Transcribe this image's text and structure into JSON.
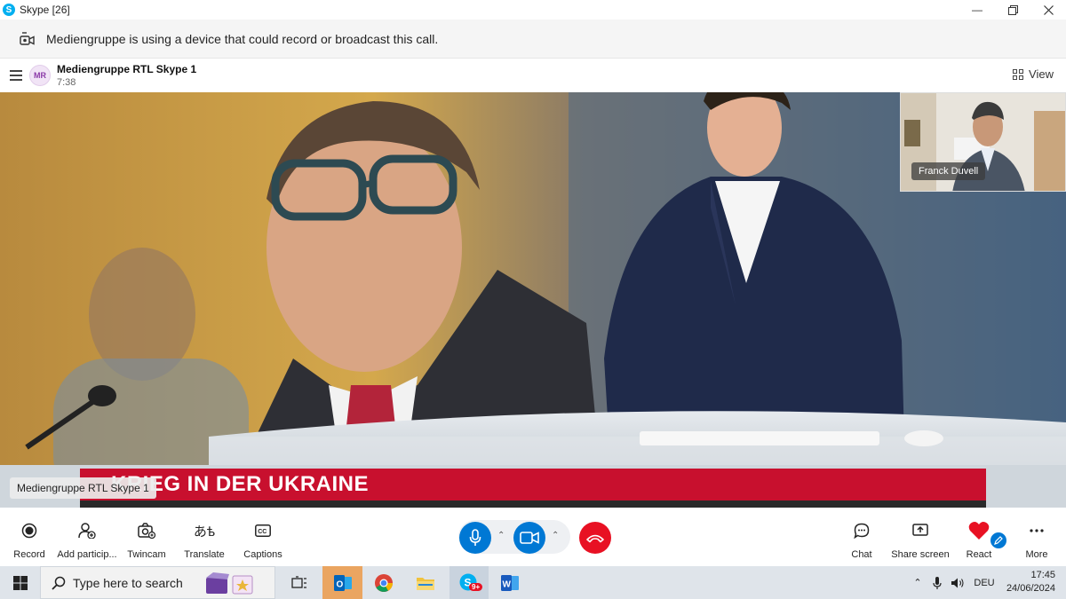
{
  "window": {
    "title": "Skype [26]"
  },
  "banner": {
    "text": "Mediengruppe is using a device that could record or broadcast this call."
  },
  "call": {
    "avatar_initials": "MR",
    "name": "Mediengruppe RTL Skype 1",
    "duration": "7:38",
    "view_label": "View"
  },
  "video": {
    "pip_name": "Franck Duvell",
    "ticker_headline": "KRIEG IN DER UKRAINE",
    "caller_label": "Mediengruppe RTL Skype 1"
  },
  "controls": {
    "record": "Record",
    "add_participants": "Add particip...",
    "twincam": "Twincam",
    "translate": "Translate",
    "captions": "Captions",
    "chat": "Chat",
    "share_screen": "Share screen",
    "react": "React",
    "more": "More"
  },
  "taskbar": {
    "search_placeholder": "Type here to search",
    "skype_badge": "9+",
    "language": "DEU",
    "time": "17:45",
    "date": "24/06/2024"
  },
  "colors": {
    "accent": "#0078d4",
    "hangup": "#e81123",
    "ticker": "#c8102e",
    "react": "#e81123"
  }
}
